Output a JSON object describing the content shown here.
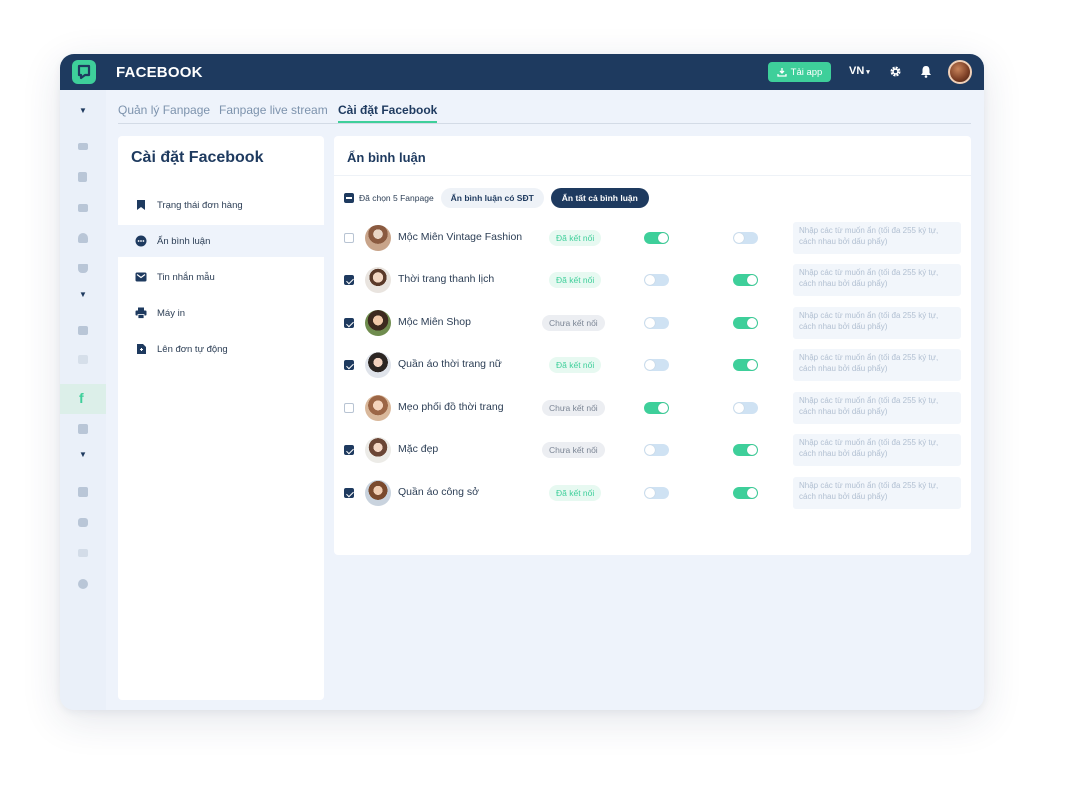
{
  "header": {
    "title": "FACEBOOK",
    "download_label": "Tải app",
    "language": "VN"
  },
  "tabs": [
    {
      "label": "Quản lý Fanpage",
      "active": false
    },
    {
      "label": "Fanpage live stream",
      "active": false
    },
    {
      "label": "Cài đặt Facebook",
      "active": true
    }
  ],
  "left_panel": {
    "title": "Cài đặt Facebook",
    "items": [
      {
        "label": "Trạng thái đơn hàng",
        "icon": "bookmark-icon",
        "active": false
      },
      {
        "label": "Ẩn bình luận",
        "icon": "comment-icon",
        "active": true
      },
      {
        "label": "Tin nhắn mẫu",
        "icon": "mail-icon",
        "active": false
      },
      {
        "label": "Máy in",
        "icon": "printer-icon",
        "active": false
      },
      {
        "label": "Lên đơn tự động",
        "icon": "auto-order-icon",
        "active": false
      }
    ]
  },
  "main": {
    "title": "Ẩn bình luận",
    "selected_label": "Đã chọn 5 Fanpage",
    "btn_hide_phone": "Ẩn bình luận có SĐT",
    "btn_hide_all": "Ẩn tất cả bình luận",
    "keyword_placeholder": "Nhập các từ muốn ẩn (tối đa 255 ký tự, cách nhau bởi dấu phẩy)",
    "rows": [
      {
        "checked": false,
        "name": "Mộc Miên Vintage Fashion",
        "status": "Đã kết nối",
        "connected": true,
        "toggle_phone": true,
        "toggle_all": false
      },
      {
        "checked": true,
        "name": "Thời trang thanh lịch",
        "status": "Đã kết nối",
        "connected": true,
        "toggle_phone": false,
        "toggle_all": true
      },
      {
        "checked": true,
        "name": "Mộc Miên Shop",
        "status": "Chưa kết nối",
        "connected": false,
        "toggle_phone": false,
        "toggle_all": true
      },
      {
        "checked": true,
        "name": "Quần áo thời trang nữ",
        "status": "Đã kết nối",
        "connected": true,
        "toggle_phone": false,
        "toggle_all": true
      },
      {
        "checked": false,
        "name": "Mẹo phối đồ thời trang",
        "status": "Chưa kết nối",
        "connected": false,
        "toggle_phone": true,
        "toggle_all": false
      },
      {
        "checked": true,
        "name": "Mặc đẹp",
        "status": "Chưa kết nối",
        "connected": false,
        "toggle_phone": false,
        "toggle_all": true
      },
      {
        "checked": true,
        "name": "Quần áo công sở",
        "status": "Đã kết nối",
        "connected": true,
        "toggle_phone": false,
        "toggle_all": true
      }
    ]
  },
  "colors": {
    "navy": "#1e3a5f",
    "accent_green": "#3ecf9a",
    "background": "#eef3fb"
  }
}
